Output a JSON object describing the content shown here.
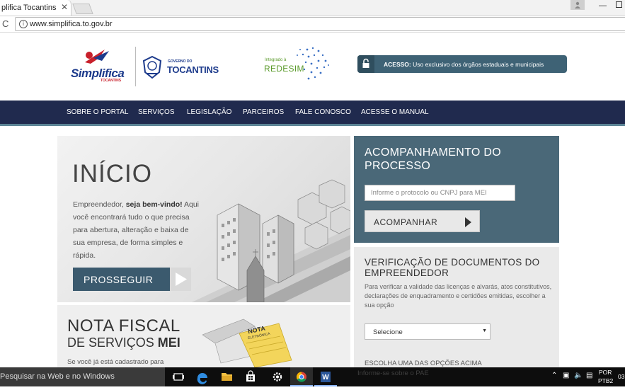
{
  "browser": {
    "tab_title": "Simplifica Tocantins",
    "tab_title_visible": "plifica Tocantins",
    "close_glyph": "✕",
    "url": "www.simplifica.to.gov.br",
    "reload_glyph": "C"
  },
  "header": {
    "logo_main": "Simplifica",
    "logo_sub": "TOCANTINS",
    "gov_small": "GOVERNO DO",
    "gov_big": "TOCANTINS",
    "redesim_small": "Integrado à",
    "redesim_name": "REDESIM",
    "access_bold": "ACESSO:",
    "access_text": " Uso exclusivo dos órgãos estaduais e municipais"
  },
  "nav": {
    "items": [
      "SOBRE O PORTAL",
      "SERVIÇOS",
      "LEGISLAÇÃO",
      "PARCEIROS",
      "FALE CONOSCO",
      "ACESSE O MANUAL"
    ]
  },
  "hero": {
    "title": "INÍCIO",
    "body_1": "Empreendedor, ",
    "body_bold": "seja bem-vindo!",
    "body_2": " Aqui você encontrará tudo o que precisa para abertura, alteração e baixa de sua empresa, de forma simples e rápida.",
    "button": "PROSSEGUIR"
  },
  "tracking": {
    "title": "ACOMPANHAMENTO DO PROCESSO",
    "placeholder": "Informe o protocolo ou CNPJ para MEI",
    "button": "ACOMPANHAR"
  },
  "verification": {
    "title": "VERIFICAÇÃO DE DOCUMENTOS DO EMPREENDEDOR",
    "body": "Para verificar a validade das licenças e alvarás, atos constitutivos, declarações de enquadramento e certidões emitidas, escolher a sua opção",
    "select_value": "Selecione",
    "note": "ESCOLHA UMA DAS OPÇÕES ACIMA"
  },
  "nota": {
    "title": "NOTA FISCAL",
    "sub_prefix": "DE SERVIÇOS ",
    "sub_bold": "MEI",
    "body": "Se você já está cadastrado para",
    "stamp_1": "NOTA",
    "stamp_2": "ELETRÔNICA"
  },
  "taskbar": {
    "search_text": "Pesquisar na Web e no Windows",
    "overlay_text": "Informe-se sobre o PAE",
    "lang_1": "POR",
    "lang_2": "PTB2",
    "clock": "03"
  },
  "colors": {
    "nav_bg": "#202a4e",
    "accent_teal": "#4a6878",
    "access_bg": "#3e6275",
    "brand_blue": "#1d3b8c",
    "brand_red": "#c8202b",
    "redesim_green": "#5a9a2a"
  }
}
